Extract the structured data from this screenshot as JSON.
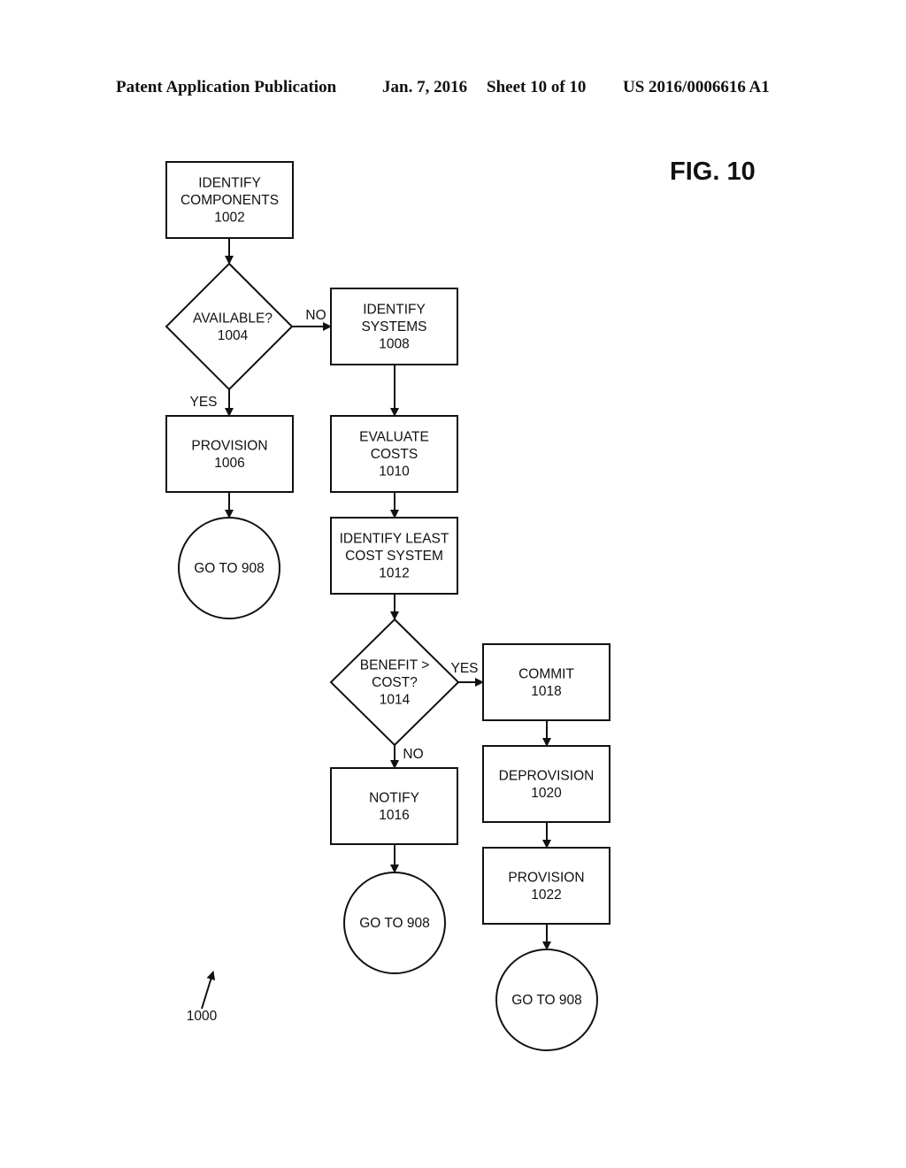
{
  "header": {
    "publication": "Patent Application Publication",
    "date": "Jan. 7, 2016",
    "sheet": "Sheet 10 of 10",
    "number": "US 2016/0006616 A1"
  },
  "figure_label": "FIG. 10",
  "reference_label": "1000",
  "nodes": [
    {
      "id": "1002",
      "shape": "rect",
      "lines": [
        "IDENTIFY",
        "COMPONENTS",
        "1002"
      ]
    },
    {
      "id": "1004",
      "shape": "diamond",
      "lines": [
        "AVAILABLE?",
        "1004"
      ]
    },
    {
      "id": "1006",
      "shape": "rect",
      "lines": [
        "PROVISION",
        "1006"
      ]
    },
    {
      "id": "goto_a",
      "shape": "circle",
      "lines": [
        "GO TO 908"
      ]
    },
    {
      "id": "1008",
      "shape": "rect",
      "lines": [
        "IDENTIFY",
        "SYSTEMS",
        "1008"
      ]
    },
    {
      "id": "1010",
      "shape": "rect",
      "lines": [
        "EVALUATE",
        "COSTS",
        "1010"
      ]
    },
    {
      "id": "1012",
      "shape": "rect",
      "lines": [
        "IDENTIFY LEAST",
        "COST SYSTEM",
        "1012"
      ]
    },
    {
      "id": "1014",
      "shape": "diamond",
      "lines": [
        "BENEFIT >",
        "COST?",
        "1014"
      ]
    },
    {
      "id": "1016",
      "shape": "rect",
      "lines": [
        "NOTIFY",
        "1016"
      ]
    },
    {
      "id": "goto_b",
      "shape": "circle",
      "lines": [
        "GO TO 908"
      ]
    },
    {
      "id": "1018",
      "shape": "rect",
      "lines": [
        "COMMIT",
        "1018"
      ]
    },
    {
      "id": "1020",
      "shape": "rect",
      "lines": [
        "DEPROVISION",
        "1020"
      ]
    },
    {
      "id": "1022",
      "shape": "rect",
      "lines": [
        "PROVISION",
        "1022"
      ]
    },
    {
      "id": "goto_c",
      "shape": "circle",
      "lines": [
        "GO TO 908"
      ]
    }
  ],
  "edges": [
    {
      "from": "1002",
      "to": "1004",
      "label": ""
    },
    {
      "from": "1004",
      "to": "1006",
      "label": "YES"
    },
    {
      "from": "1004",
      "to": "1008",
      "label": "NO"
    },
    {
      "from": "1006",
      "to": "goto_a",
      "label": ""
    },
    {
      "from": "1008",
      "to": "1010",
      "label": ""
    },
    {
      "from": "1010",
      "to": "1012",
      "label": ""
    },
    {
      "from": "1012",
      "to": "1014",
      "label": ""
    },
    {
      "from": "1014",
      "to": "1018",
      "label": "YES"
    },
    {
      "from": "1014",
      "to": "1016",
      "label": "NO"
    },
    {
      "from": "1016",
      "to": "goto_b",
      "label": ""
    },
    {
      "from": "1018",
      "to": "1020",
      "label": ""
    },
    {
      "from": "1020",
      "to": "1022",
      "label": ""
    },
    {
      "from": "1022",
      "to": "goto_c",
      "label": ""
    }
  ]
}
